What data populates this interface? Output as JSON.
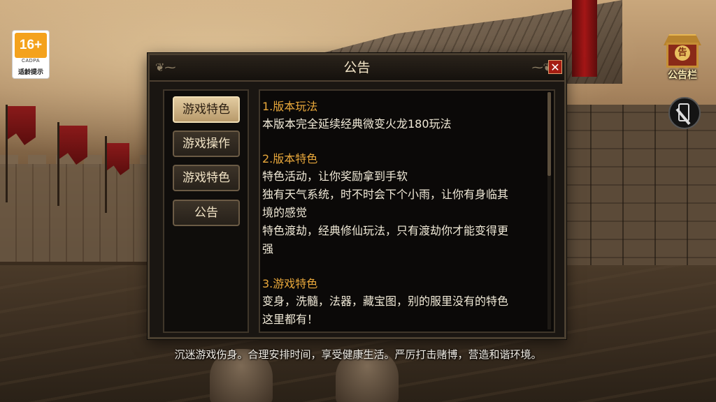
{
  "rating": {
    "age": "16+",
    "org": "CADPA",
    "tip": "适龄提示"
  },
  "notice_icon": {
    "coin": "告",
    "label": "公告栏"
  },
  "dialog": {
    "title": "公告",
    "close": "✕",
    "tabs": [
      {
        "label": "游戏特色",
        "active": true
      },
      {
        "label": "游戏操作",
        "active": false
      },
      {
        "label": "游戏特色",
        "active": false
      },
      {
        "label": "公告",
        "active": false
      }
    ],
    "content": {
      "s1_title": "1.版本玩法",
      "s1_lines": [
        "本版本完全延续经典微变火龙180玩法"
      ],
      "s2_title": "2.版本特色",
      "s2_lines": [
        "特色活动，让你奖励拿到手软",
        "独有天气系统，时不时会下个小雨，让你有身临其",
        "境的感觉",
        "特色渡劫，经典修仙玩法，只有渡劫你才能变得更",
        "强"
      ],
      "s3_title": "3.游戏特色",
      "s3_lines": [
        "变身，洗髓，法器，藏宝图，别的服里没有的特色",
        "这里都有！"
      ]
    }
  },
  "footer": "沉迷游戏伤身。合理安排时间，享受健康生活。严厉打击赌博，营造和谐环境。"
}
